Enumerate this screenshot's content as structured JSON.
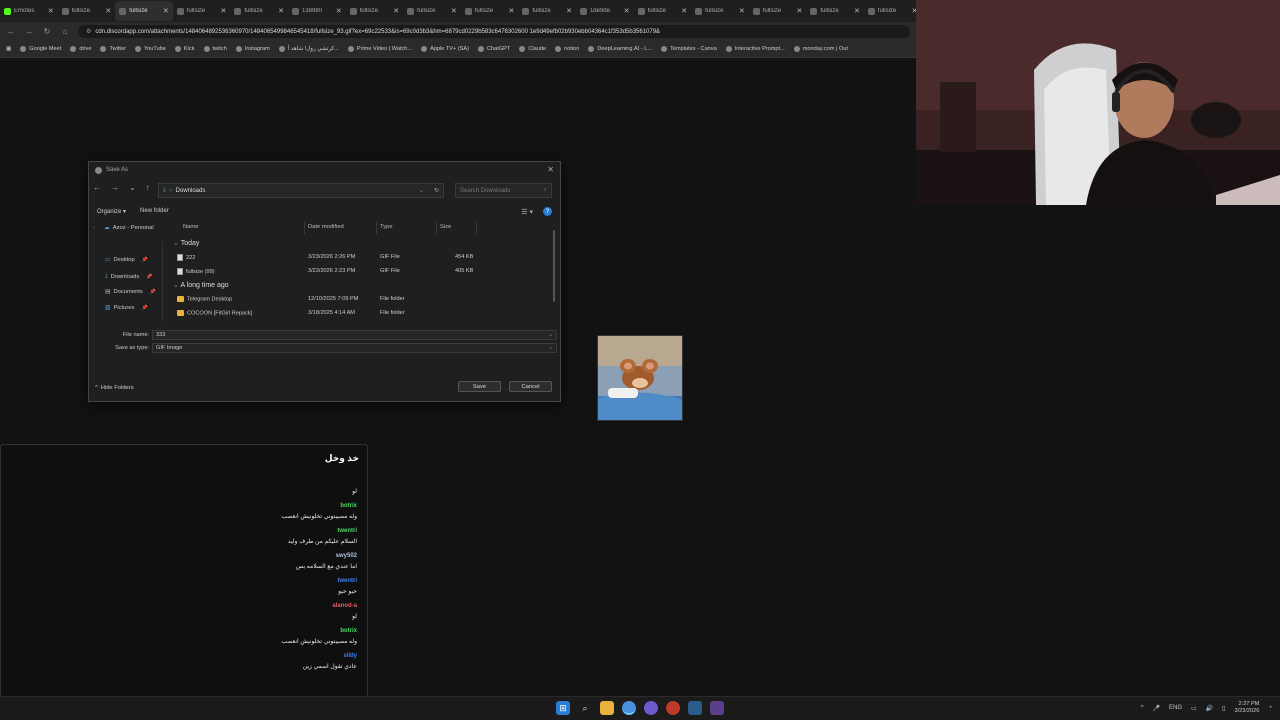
{
  "browser": {
    "tabs": [
      {
        "label": "Emotes",
        "active": false,
        "icon": "kick-icon"
      },
      {
        "label": "fullsize",
        "active": false,
        "icon": "globe-icon"
      },
      {
        "label": "fullsize",
        "active": true,
        "icon": "globe-icon"
      },
      {
        "label": "fullsize",
        "active": false,
        "icon": "globe-icon"
      },
      {
        "label": "fullsize",
        "active": false,
        "icon": "globe-icon"
      },
      {
        "label": "138980",
        "active": false,
        "icon": "globe-icon"
      },
      {
        "label": "fullsize",
        "active": false,
        "icon": "globe-icon"
      },
      {
        "label": "fullsize",
        "active": false,
        "icon": "globe-icon"
      },
      {
        "label": "fullsize",
        "active": false,
        "icon": "globe-icon"
      },
      {
        "label": "fullsize",
        "active": false,
        "icon": "globe-icon"
      },
      {
        "label": "1de9de",
        "active": false,
        "icon": "globe-icon"
      },
      {
        "label": "fullsize",
        "active": false,
        "icon": "globe-icon"
      },
      {
        "label": "fullsize",
        "active": false,
        "icon": "globe-icon"
      },
      {
        "label": "fullsize",
        "active": false,
        "icon": "globe-icon"
      },
      {
        "label": "fullsize",
        "active": false,
        "icon": "globe-icon"
      },
      {
        "label": "fullsize",
        "active": false,
        "icon": "globe-icon"
      }
    ],
    "url": "cdn.discordapp.com/attachments/1484064892536360970/1484065499846545418/fullsize_93.gif?ex=69c22533&is=69c0d3b3&hm=6879cd0229b583c6476302600 1e9d49efb02b930ebb04364c1f353d5b3561079&",
    "bookmarks": [
      "Google Meet",
      "drive",
      "Twitter",
      "YouTube",
      "Kick",
      "twitch",
      "Instagram",
      "كرتشي رول! شاهد أ...",
      "Prime Video | Watch...",
      "Apple TV+ (SA)",
      "ChatGPT",
      "Claude",
      "notion",
      "DeepLearning.AI - L...",
      "Templates - Canva",
      "Interactive Prompt...",
      "monday.com | Out"
    ]
  },
  "dialog": {
    "title": "Save As",
    "path": "Downloads",
    "search_placeholder": "Search Downloads",
    "organize": "Organize",
    "new_folder": "New folder",
    "sidebar": {
      "account": "Azoz - Personal",
      "items": [
        "Desktop",
        "Downloads",
        "Documents",
        "Pictures"
      ]
    },
    "columns": {
      "name": "Name",
      "date": "Date modified",
      "type": "Type",
      "size": "Size"
    },
    "groups": [
      {
        "label": "Today",
        "files": [
          {
            "name": "222",
            "date": "3/23/2026 2:26 PM",
            "type": "GIF File",
            "size": "454 KB",
            "kind": "gif"
          },
          {
            "name": "fullsize (99)",
            "date": "3/23/2026 2:23 PM",
            "type": "GIF File",
            "size": "405 KB",
            "kind": "gif"
          }
        ]
      },
      {
        "label": "A long time ago",
        "files": [
          {
            "name": "Telegram Desktop",
            "date": "12/10/2025 7:09 PM",
            "type": "File folder",
            "size": "",
            "kind": "folder"
          },
          {
            "name": "COCOON [FitGirl Repack]",
            "date": "3/18/2025 4:14 AM",
            "type": "File folder",
            "size": "",
            "kind": "folder"
          }
        ]
      }
    ],
    "file_name_label": "File name:",
    "file_name_value": "333",
    "save_as_type_label": "Save as type:",
    "save_as_type_value": "GIF Image",
    "hide_folders": "Hide Folders",
    "save": "Save",
    "cancel": "Cancel"
  },
  "chat": {
    "title": "خذ وخل",
    "messages": [
      {
        "user": "",
        "text": "لو",
        "color": "#ffffff"
      },
      {
        "user": "botrix",
        "text": "وله مصيبتوني تخلونيش انعصب",
        "color": "#4cd964"
      },
      {
        "user": "twentri",
        "text": "السلام عليكم من طرف وليد",
        "color": "#4cd964"
      },
      {
        "user": "swy502",
        "text": "اما عندي مع السلامه بس",
        "color": "#b0c4de"
      },
      {
        "user": "twentri",
        "text": "حيو حيو",
        "color": "#3b82f6"
      },
      {
        "user": "alanod-a",
        "text": "لو",
        "color": "#e05a6a"
      },
      {
        "user": "botrix",
        "text": "وله مصيبتوني تخلونيش انعصب",
        "color": "#4cd964"
      },
      {
        "user": "sildy",
        "text": "عادي تقول اسمي زين",
        "color": "#3b82f6"
      }
    ]
  },
  "taskbar": {
    "language": "ENG",
    "time": "2:27 PM",
    "date": "3/23/2026"
  }
}
